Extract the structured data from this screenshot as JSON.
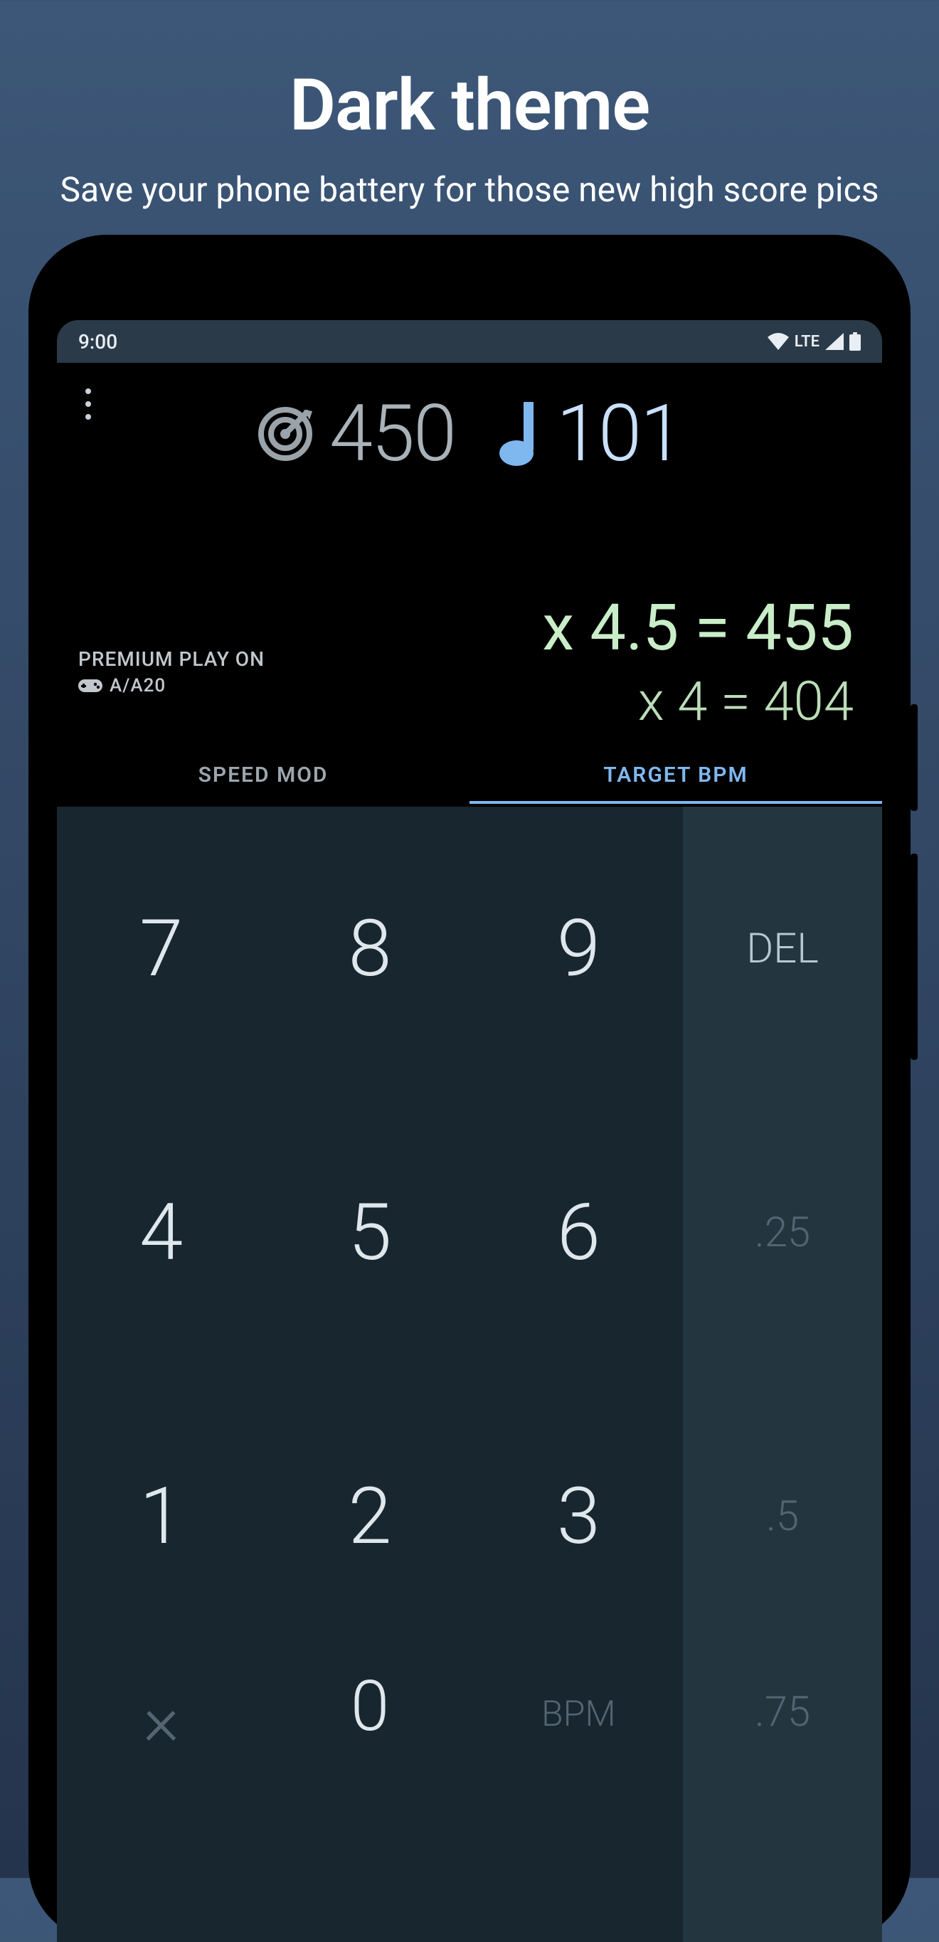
{
  "promo": {
    "title": "Dark theme",
    "subtitle": "Save your phone battery for those new high score pics"
  },
  "statusbar": {
    "time": "9:00",
    "network": "LTE"
  },
  "readout": {
    "target": "450",
    "bpm": "101"
  },
  "results": {
    "main": "x 4.5 = 455",
    "sub": "x 4 = 404"
  },
  "mode": {
    "line1": "PREMIUM PLAY ON",
    "line2": "A/A20"
  },
  "tabs": {
    "speed_mod": "SPEED MOD",
    "target_bpm": "TARGET BPM"
  },
  "keypad": {
    "k7": "7",
    "k8": "8",
    "k9": "9",
    "del": "DEL",
    "k4": "4",
    "k5": "5",
    "k6": "6",
    "q25": ".25",
    "k1": "1",
    "k2": "2",
    "k3": "3",
    "q5": ".5",
    "kx": "×",
    "k0": "0",
    "kblank": "",
    "q75": ".75",
    "bpm_label": "BPM"
  }
}
